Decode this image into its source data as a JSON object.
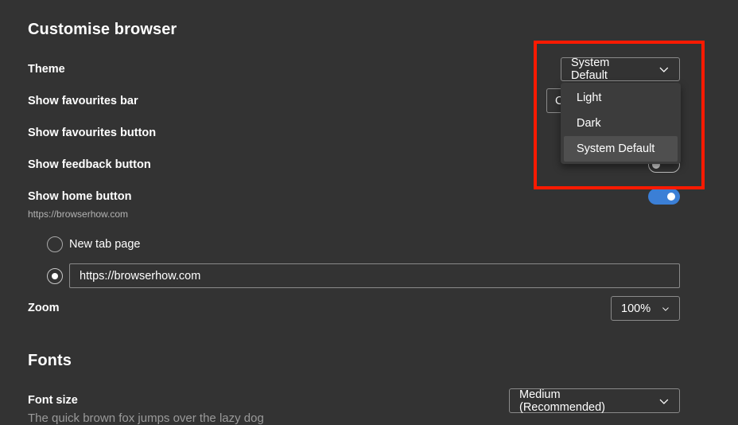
{
  "section_customise": {
    "title": "Customise browser",
    "rows": {
      "theme": "Theme",
      "favourites_bar": "Show favourites bar",
      "favourites_button": "Show favourites button",
      "feedback_button": "Show feedback button",
      "home_button": "Show home button",
      "home_url_subtext": "https://browserhow.com",
      "zoom": "Zoom"
    },
    "theme_select": {
      "value": "System Default",
      "options": [
        "Light",
        "Dark",
        "System Default"
      ],
      "selected_index": 2
    },
    "favourites_bar_select_partial": "C",
    "home_button_toggle": "on",
    "feedback_button_toggle": "off",
    "home_options": {
      "new_tab_label": "New tab page",
      "custom_url_value": "https://browserhow.com",
      "selected": "custom"
    },
    "zoom_select": {
      "value": "100%"
    }
  },
  "section_fonts": {
    "title": "Fonts",
    "font_size_label": "Font size",
    "font_size_value": "Medium (Recommended)",
    "preview_text": "The quick brown fox jumps over the lazy dog"
  },
  "colors": {
    "background": "#333333",
    "accent": "#3b7fd6",
    "highlight": "#ff1a00"
  }
}
